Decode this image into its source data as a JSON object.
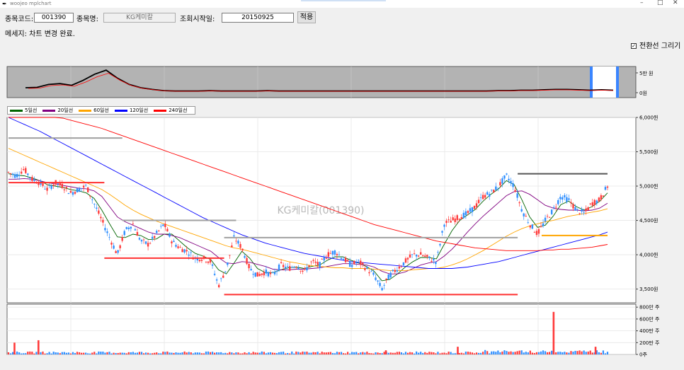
{
  "window": {
    "title": "woojeo mplchart",
    "controls": [
      "–",
      "□",
      "✕"
    ]
  },
  "toolbar": {
    "code_label": "종목코드:",
    "code_value": "001390",
    "name_label": "종목명:",
    "name_value": "KG케미칼",
    "start_label": "조회시작일:",
    "start_value": "20150925",
    "apply_label": "적용"
  },
  "message": "메세지: 차트 변경 완료.",
  "checkbox": {
    "label": "전환선 그리기",
    "checked": true
  },
  "colors": {
    "ma5": "#006400",
    "ma20": "#800080",
    "ma60": "#FFA500",
    "ma120": "#0000FF",
    "ma240": "#FF0000",
    "up": "#ff3b3b",
    "down": "#2f8fff",
    "level_gray": "#a0a0a0",
    "level_red": "#ff3030",
    "level_dark": "#555555",
    "level_orange": "#FFA500",
    "overview_bg": "#b3b3b3",
    "selection": "#3a85ff"
  },
  "legend": [
    {
      "label": "5일선",
      "color": "#006400"
    },
    {
      "label": "20일선",
      "color": "#800080"
    },
    {
      "label": "60일선",
      "color": "#FFA500"
    },
    {
      "label": "120일선",
      "color": "#0000FF"
    },
    {
      "label": "240일선",
      "color": "#FF0000"
    }
  ],
  "overview": {
    "y_ticks": [
      "5만 원",
      "0원"
    ]
  },
  "price_chart": {
    "watermark": "KG케미칼(001390)",
    "y_ticks": [
      "6,000원",
      "5,500원",
      "5,000원",
      "4,500원",
      "4,000원",
      "3,500원"
    ]
  },
  "volume_chart": {
    "y_ticks": [
      "800만 주",
      "600만 주",
      "400만 주",
      "200만 주",
      "0주"
    ]
  },
  "chart_data": {
    "type": "candlestick",
    "title": "KG케미칼(001390)",
    "ylim": [
      3300,
      6000
    ],
    "y_ticks": [
      6000,
      5500,
      5000,
      4500,
      4000,
      3500
    ],
    "volume_ylim": [
      0,
      8500000
    ],
    "volume_ticks": [
      8000000,
      6000000,
      4000000,
      2000000,
      0
    ],
    "close_path": [
      5200,
      5150,
      5250,
      5100,
      5050,
      4950,
      5050,
      5000,
      4900,
      4950,
      5000,
      4750,
      4500,
      4250,
      4000,
      4350,
      4450,
      4200,
      4150,
      4300,
      4450,
      4200,
      4100,
      4050,
      3950,
      3950,
      3900,
      3550,
      3800,
      4250,
      4100,
      3800,
      3700,
      3750,
      3700,
      3850,
      3800,
      3850,
      3750,
      3900,
      3850,
      4000,
      4050,
      3950,
      3850,
      3900,
      3800,
      3700,
      3500,
      3700,
      3800,
      3900,
      4000,
      4000,
      3950,
      3900,
      4450,
      4500,
      4550,
      4600,
      4700,
      4850,
      4900,
      5000,
      5150,
      5000,
      4650,
      4450,
      4300,
      4500,
      4650,
      4850,
      4800,
      4650,
      4600,
      4750,
      4800,
      5000
    ],
    "moving_averages": [
      {
        "name": "5일선",
        "values": [
          5180,
          5160,
          5150,
          5120,
          5080,
          5020,
          5000,
          4980,
          4950,
          4930,
          4900,
          4820,
          4650,
          4450,
          4260,
          4250,
          4300,
          4280,
          4220,
          4230,
          4300,
          4300,
          4200,
          4100,
          4020,
          3980,
          3930,
          3780,
          3720,
          3880,
          4050,
          3950,
          3800,
          3740,
          3740,
          3780,
          3810,
          3820,
          3800,
          3830,
          3850,
          3920,
          3970,
          3970,
          3920,
          3880,
          3830,
          3760,
          3620,
          3640,
          3720,
          3820,
          3900,
          3960,
          3960,
          3940,
          4150,
          4350,
          4500,
          4580,
          4660,
          4780,
          4880,
          4960,
          5080,
          5020,
          4800,
          4550,
          4400,
          4430,
          4560,
          4730,
          4780,
          4700,
          4650,
          4700,
          4780,
          4900
        ]
      },
      {
        "name": "20일선",
        "values": [
          5100,
          5100,
          5110,
          5100,
          5080,
          5050,
          5030,
          5010,
          4990,
          4970,
          4960,
          4930,
          4850,
          4700,
          4550,
          4480,
          4430,
          4380,
          4330,
          4300,
          4300,
          4280,
          4250,
          4200,
          4150,
          4100,
          4050,
          3960,
          3880,
          3870,
          3900,
          3890,
          3860,
          3830,
          3790,
          3780,
          3780,
          3790,
          3790,
          3800,
          3810,
          3830,
          3850,
          3870,
          3870,
          3860,
          3850,
          3820,
          3760,
          3720,
          3720,
          3750,
          3800,
          3850,
          3880,
          3900,
          3980,
          4080,
          4200,
          4330,
          4450,
          4560,
          4660,
          4760,
          4860,
          4920,
          4930,
          4880,
          4800,
          4720,
          4680,
          4660,
          4650,
          4650,
          4640,
          4650,
          4680,
          4750
        ]
      },
      {
        "name": "60일선",
        "values": [
          5550,
          5500,
          5450,
          5400,
          5350,
          5300,
          5250,
          5200,
          5150,
          5100,
          5050,
          5000,
          4950,
          4880,
          4800,
          4720,
          4650,
          4590,
          4540,
          4490,
          4450,
          4410,
          4370,
          4330,
          4290,
          4250,
          4210,
          4170,
          4130,
          4100,
          4080,
          4050,
          4020,
          3990,
          3960,
          3930,
          3900,
          3880,
          3860,
          3840,
          3830,
          3820,
          3810,
          3810,
          3800,
          3800,
          3800,
          3790,
          3780,
          3770,
          3770,
          3770,
          3780,
          3790,
          3800,
          3800,
          3820,
          3850,
          3890,
          3940,
          4000,
          4060,
          4130,
          4200,
          4270,
          4330,
          4380,
          4420,
          4450,
          4480,
          4500,
          4530,
          4560,
          4580,
          4600,
          4620,
          4640,
          4670
        ]
      },
      {
        "name": "120일선",
        "values": [
          6000,
          5950,
          5900,
          5850,
          5800,
          5740,
          5680,
          5620,
          5560,
          5500,
          5440,
          5380,
          5320,
          5260,
          5200,
          5140,
          5080,
          5020,
          4960,
          4900,
          4840,
          4780,
          4720,
          4660,
          4600,
          4540,
          4490,
          4440,
          4390,
          4340,
          4290,
          4250,
          4210,
          4170,
          4140,
          4110,
          4080,
          4050,
          4020,
          4000,
          3980,
          3960,
          3940,
          3920,
          3900,
          3890,
          3880,
          3870,
          3860,
          3850,
          3840,
          3830,
          3820,
          3810,
          3800,
          3800,
          3800,
          3800,
          3810,
          3820,
          3840,
          3860,
          3880,
          3900,
          3930,
          3960,
          3990,
          4020,
          4050,
          4080,
          4110,
          4140,
          4170,
          4200,
          4230,
          4260,
          4290,
          4330
        ]
      },
      {
        "name": "240일선",
        "values": [
          6200,
          6170,
          6140,
          6110,
          6080,
          6050,
          6020,
          5990,
          5960,
          5930,
          5900,
          5870,
          5840,
          5800,
          5760,
          5720,
          5680,
          5640,
          5600,
          5560,
          5520,
          5480,
          5440,
          5400,
          5360,
          5320,
          5280,
          5240,
          5200,
          5160,
          5120,
          5080,
          5040,
          5000,
          4960,
          4920,
          4880,
          4840,
          4800,
          4760,
          4720,
          4680,
          4640,
          4600,
          4560,
          4520,
          4480,
          4440,
          4410,
          4380,
          4350,
          4320,
          4290,
          4260,
          4230,
          4200,
          4180,
          4160,
          4140,
          4120,
          4100,
          4090,
          4080,
          4070,
          4060,
          4060,
          4060,
          4060,
          4060,
          4070,
          4070,
          4080,
          4080,
          4090,
          4100,
          4110,
          4130,
          4150
        ]
      }
    ],
    "levels": [
      {
        "color": "gray",
        "price": 5700,
        "from": 0.0,
        "to": 0.19
      },
      {
        "color": "red",
        "price": 5050,
        "from": 0.0,
        "to": 0.16
      },
      {
        "color": "gray",
        "price": 4500,
        "from": 0.19,
        "to": 0.38
      },
      {
        "color": "red",
        "price": 3950,
        "from": 0.16,
        "to": 0.36
      },
      {
        "color": "gray",
        "price": 4250,
        "from": 0.36,
        "to": 0.85
      },
      {
        "color": "red",
        "price": 3420,
        "from": 0.36,
        "to": 0.85
      },
      {
        "color": "dark",
        "price": 5180,
        "from": 0.85,
        "to": 1.0
      },
      {
        "color": "orange",
        "price": 4280,
        "from": 0.89,
        "to": 1.0
      }
    ],
    "volume_spikes": [
      {
        "at": 0.01,
        "value": 2000000
      },
      {
        "at": 0.05,
        "value": 2400000
      },
      {
        "at": 0.63,
        "value": 700000
      },
      {
        "at": 0.75,
        "value": 1300000
      },
      {
        "at": 0.91,
        "value": 7200000
      },
      {
        "at": 0.98,
        "value": 1300000
      }
    ],
    "overview_series": [
      0.12,
      0.13,
      0.2,
      0.22,
      0.18,
      0.3,
      0.45,
      0.55,
      0.35,
      0.2,
      0.12,
      0.08,
      0.05,
      0.04,
      0.04,
      0.04,
      0.05,
      0.04,
      0.04,
      0.04,
      0.04,
      0.05,
      0.04,
      0.04,
      0.04,
      0.04,
      0.04,
      0.04,
      0.04,
      0.04,
      0.04,
      0.04,
      0.04,
      0.04,
      0.04,
      0.04,
      0.04,
      0.04,
      0.04,
      0.04,
      0.04,
      0.05,
      0.05,
      0.06,
      0.06,
      0.07,
      0.08,
      0.08,
      0.07,
      0.06,
      0.07,
      0.06
    ],
    "legend": [
      "5일선",
      "20일선",
      "60일선",
      "120일선",
      "240일선"
    ]
  }
}
